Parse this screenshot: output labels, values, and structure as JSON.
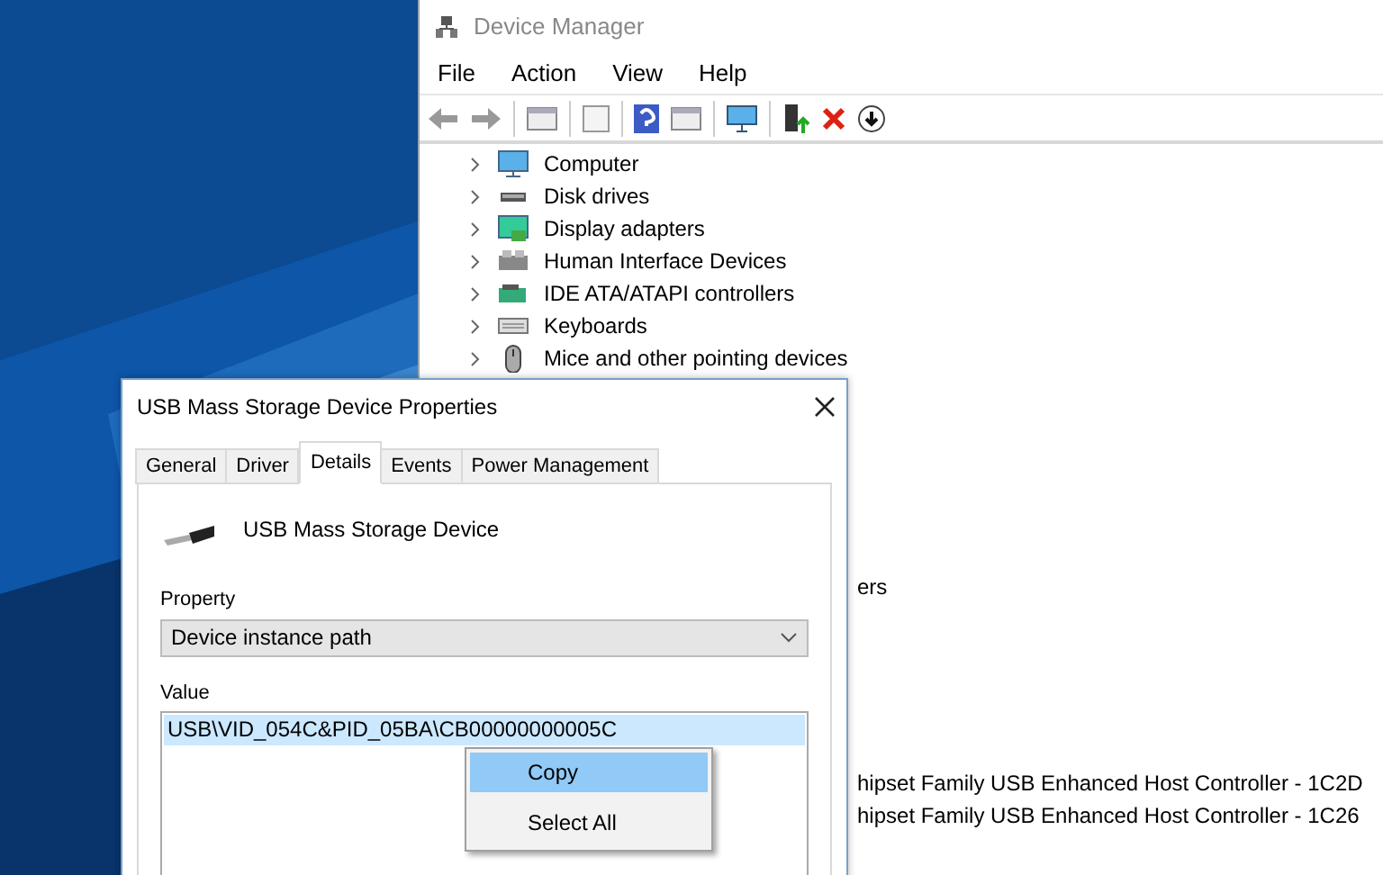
{
  "device_manager": {
    "title": "Device Manager",
    "menu": [
      "File",
      "Action",
      "View",
      "Help"
    ],
    "tree": [
      {
        "label": "Computer",
        "expanded": false,
        "kind": "monitor"
      },
      {
        "label": "Disk drives",
        "expanded": false,
        "kind": "disk"
      },
      {
        "label": "Display adapters",
        "expanded": false,
        "kind": "display"
      },
      {
        "label": "Human Interface Devices",
        "expanded": false,
        "kind": "hid"
      },
      {
        "label": "IDE ATA/ATAPI controllers",
        "expanded": false,
        "kind": "ide"
      },
      {
        "label": "Keyboards",
        "expanded": false,
        "kind": "keyboard"
      },
      {
        "label": "Mice and other pointing devices",
        "expanded": false,
        "kind": "mouse"
      }
    ],
    "partial_rows": [
      "ers",
      "hipset Family USB Enhanced Host Controller - 1C2D",
      "hipset Family USB Enhanced Host Controller - 1C26"
    ]
  },
  "dialog": {
    "title": "USB Mass Storage Device Properties",
    "tabs": [
      {
        "label": "General",
        "selected": false
      },
      {
        "label": "Driver",
        "selected": false
      },
      {
        "label": "Details",
        "selected": true
      },
      {
        "label": "Events",
        "selected": false
      },
      {
        "label": "Power Management",
        "selected": false
      }
    ],
    "device_name": "USB Mass Storage Device",
    "property_label": "Property",
    "property_value": "Device instance path",
    "value_label": "Value",
    "values": [
      {
        "text": "USB\\VID_054C&PID_05BA\\CB00000000005C",
        "selected": true
      }
    ]
  },
  "context_menu": [
    {
      "label": "Copy",
      "selected": true
    },
    {
      "label": "Select All",
      "selected": false
    }
  ]
}
